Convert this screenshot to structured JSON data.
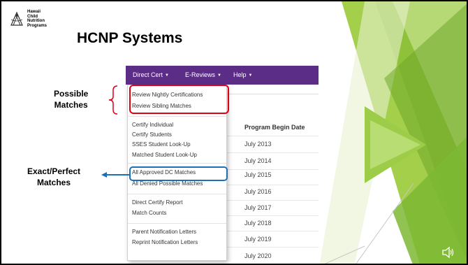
{
  "logo": {
    "lines": [
      "Hawaii",
      "Child",
      "Nutrition",
      "Programs"
    ]
  },
  "title": "HCNP Systems",
  "navbar": {
    "items": [
      {
        "label": "Direct Cert",
        "has_caret": true
      },
      {
        "label": "E-Reviews",
        "has_caret": true
      },
      {
        "label": "Help",
        "has_caret": true
      }
    ],
    "color": "#5b2d86"
  },
  "dropdown": {
    "groups": [
      [
        "Review Nightly Certifications",
        "Review Sibling Matches"
      ],
      [
        "Certify Individual",
        "Certify Students",
        "SSES Student Look-Up",
        "Matched Student Look-Up"
      ],
      [
        "All Approved DC Matches",
        "All Denied Possible Matches"
      ],
      [
        "Direct Certify Report",
        "Match Counts"
      ],
      [
        "Parent Notification Letters",
        "Reprint Notification Letters"
      ]
    ]
  },
  "table": {
    "column_header": "Program Begin Date",
    "rows": [
      "July 2013",
      "July 2014",
      "July 2015",
      "July 2016",
      "July 2017",
      "July 2018",
      "July 2019",
      "July 2020"
    ]
  },
  "annotations": {
    "possible": [
      "Possible",
      "Matches"
    ],
    "exact": [
      "Exact/Perfect",
      "Matches"
    ],
    "red_color": "#e00016",
    "blue_color": "#1f6eb8"
  },
  "icons": {
    "speaker": "speaker-icon",
    "logo": "hawaii-logo-icon"
  }
}
